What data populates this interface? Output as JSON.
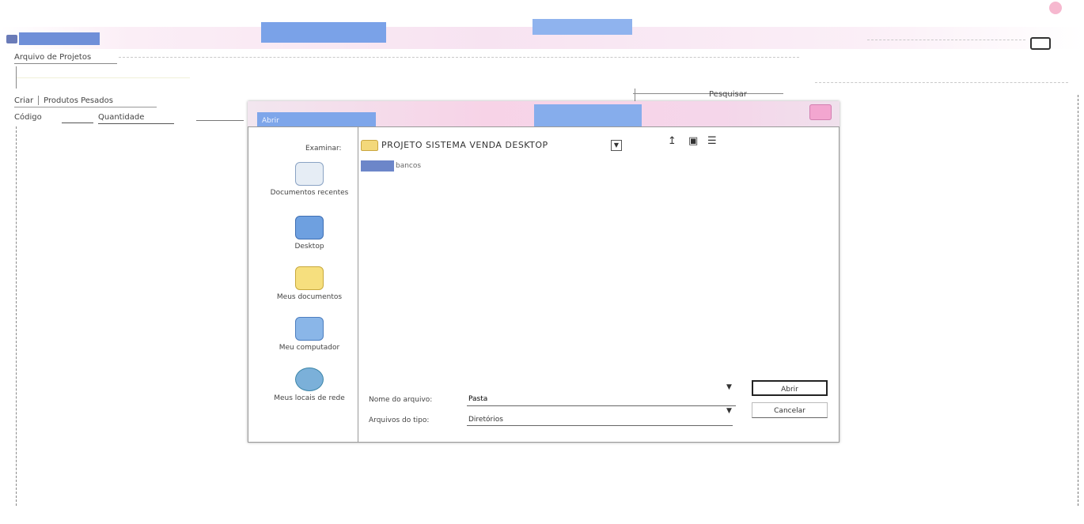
{
  "app": {
    "title": "",
    "menu_label": "Arquivo de Projetos",
    "tabs": [
      "Criar",
      "Produtos Pesados"
    ],
    "field_label": "Código",
    "field_value": "Quantidade",
    "right_label": "Pesquisar"
  },
  "dialog": {
    "title": "Abrir",
    "look_in_label": "Examinar:",
    "look_in_value": "PROJETO SISTEMA VENDA DESKTOP",
    "places": [
      {
        "label": "Documentos recentes",
        "icon": "recent-documents-icon"
      },
      {
        "label": "Desktop",
        "icon": "desktop-icon"
      },
      {
        "label": "Meus documentos",
        "icon": "my-documents-icon"
      },
      {
        "label": "Meu computador",
        "icon": "my-computer-icon"
      },
      {
        "label": "Meus locais de rede",
        "icon": "network-places-icon"
      }
    ],
    "files": [
      {
        "name": "bancos"
      }
    ],
    "file_name_label": "Nome do arquivo:",
    "file_name_value": "Pasta",
    "file_type_label": "Arquivos do tipo:",
    "file_type_value": "Diretórios",
    "open_label": "Abrir",
    "cancel_label": "Cancelar"
  },
  "colors": {
    "titlebar_pink": "#f7d3e7",
    "titlebar_blue": "#7ea6ea",
    "selection_blue": "#6c86c9"
  }
}
